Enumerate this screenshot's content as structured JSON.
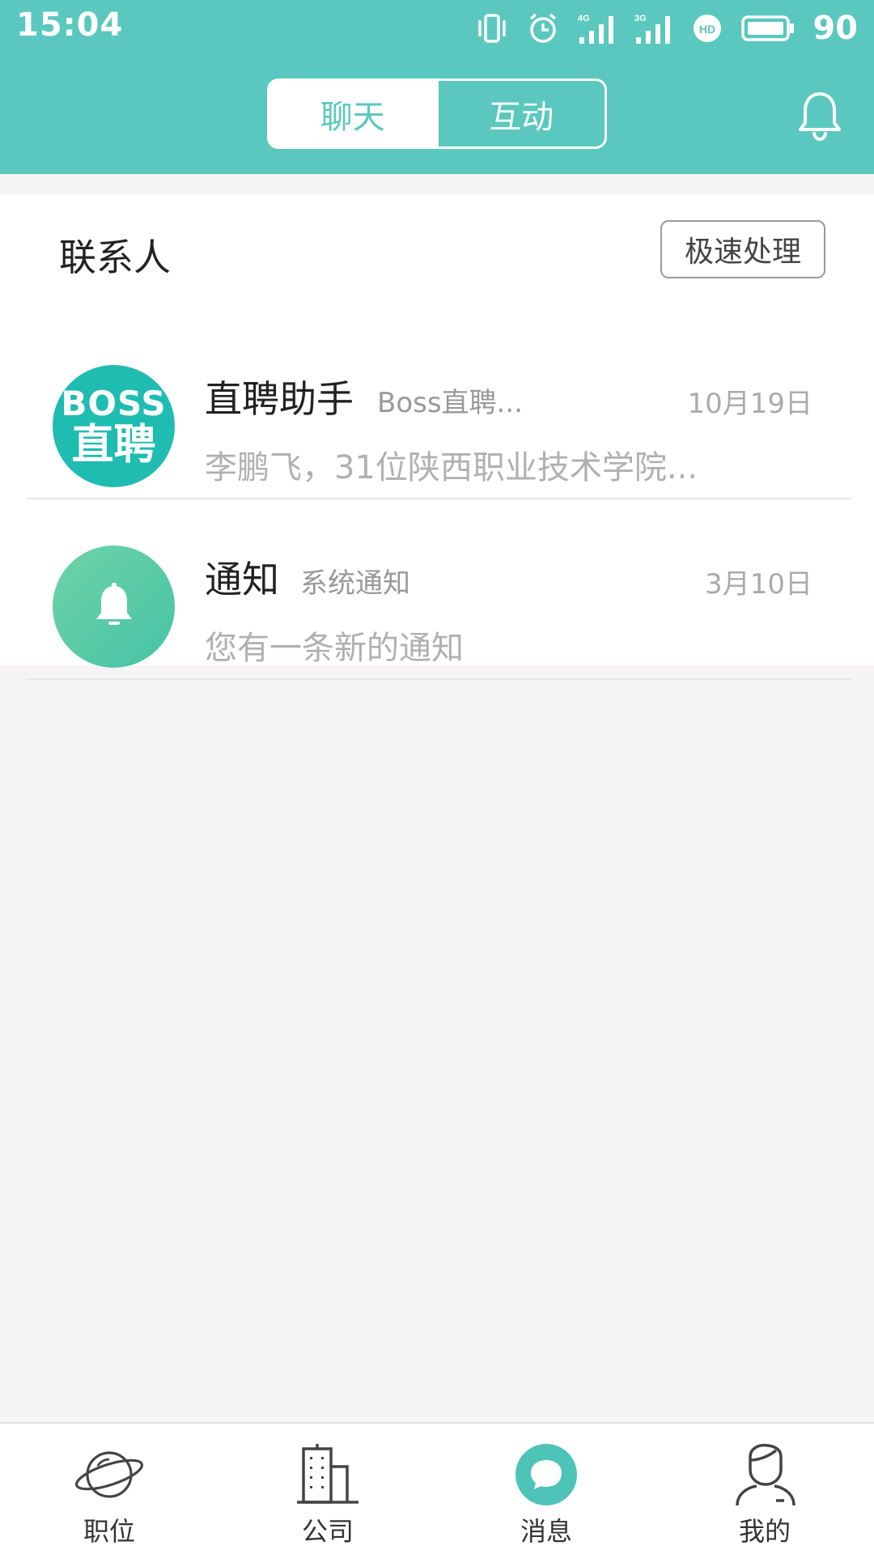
{
  "status_bar": {
    "time": "15:04",
    "battery": "90",
    "network_1": "4G",
    "network_2": "3G",
    "hd": "HD"
  },
  "header": {
    "tabs": [
      {
        "label": "聊天",
        "active": true
      },
      {
        "label": "互动",
        "active": false
      }
    ]
  },
  "contacts": {
    "title": "联系人",
    "quick_button": "极速处理",
    "items": [
      {
        "avatar_line1": "BOSS",
        "avatar_line2": "直聘",
        "name": "直聘助手",
        "subtitle": "Boss直聘...",
        "date": "10月19日",
        "message": "李鹏飞，31位陕西职业技术学院..."
      },
      {
        "name": "通知",
        "subtitle": "系统通知",
        "date": "3月10日",
        "message": "您有一条新的通知"
      }
    ]
  },
  "tab_bar": {
    "items": [
      {
        "label": "职位",
        "icon": "planet-icon"
      },
      {
        "label": "公司",
        "icon": "building-icon"
      },
      {
        "label": "消息",
        "icon": "chat-bubble-icon",
        "active": true
      },
      {
        "label": "我的",
        "icon": "profile-icon"
      }
    ]
  },
  "colors": {
    "brand": "#5ac8be",
    "boss_avatar": "#1fbcb2",
    "notice_avatar": "#5ccaa7"
  }
}
